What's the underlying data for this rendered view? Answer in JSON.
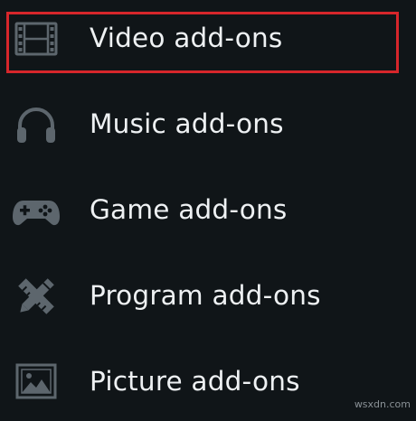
{
  "menu": {
    "items": [
      {
        "label": "Video add-ons",
        "icon": "film-icon",
        "selected": true
      },
      {
        "label": "Music add-ons",
        "icon": "headphones-icon",
        "selected": false
      },
      {
        "label": "Game add-ons",
        "icon": "gamepad-icon",
        "selected": false
      },
      {
        "label": "Program add-ons",
        "icon": "pencil-ruler-icon",
        "selected": false
      },
      {
        "label": "Picture add-ons",
        "icon": "picture-icon",
        "selected": false
      }
    ],
    "selection_color": "#d6262b",
    "text_color": "#eef1f3",
    "icon_color": "#5d666d",
    "background": "#101518"
  },
  "watermark": "wsxdn.com"
}
